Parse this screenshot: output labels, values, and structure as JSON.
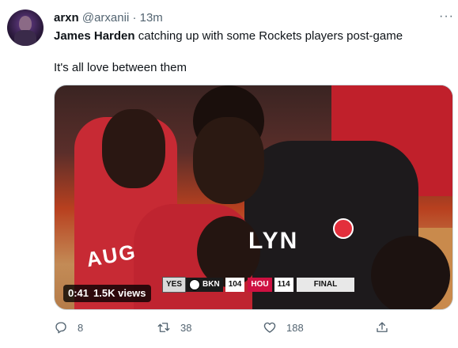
{
  "tweet": {
    "author_name": "arxn",
    "author_handle": "@arxanii",
    "separator": "·",
    "time": "13m",
    "more_label": "···",
    "text_bold": "James Harden",
    "text_rest": " catching up with some Rockets players post-game",
    "text_line2": "It's all love between them"
  },
  "media": {
    "duration": "0:41",
    "views": "1.5K views",
    "jersey_text_1": "AUG",
    "jersey_text_2": "LYN",
    "scorebug": {
      "network": "YES",
      "team1": "BKN",
      "score1": "104",
      "team2": "HOU",
      "score2": "114",
      "status": "FINAL"
    }
  },
  "actions": {
    "replies": "8",
    "retweets": "38",
    "likes": "188"
  },
  "colors": {
    "text_primary": "#0f1419",
    "text_secondary": "#536471",
    "rockets_red": "#ce1141"
  }
}
